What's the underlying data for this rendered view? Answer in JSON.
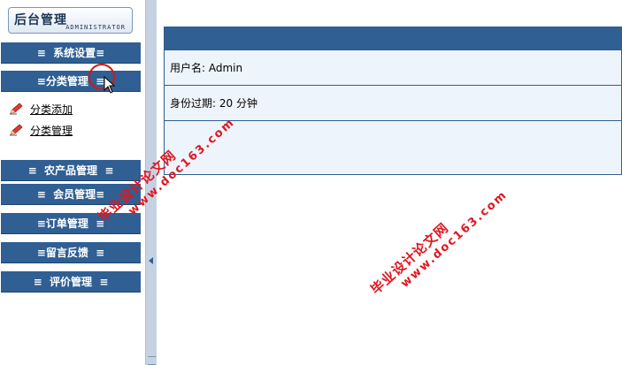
{
  "logo": {
    "title": "后台管理",
    "subtitle": "ADMINISTRATOR"
  },
  "sidebar": {
    "top_menus": [
      {
        "label": "≡  系统设置≡"
      },
      {
        "label": "≡分类管理  ≡"
      }
    ],
    "sub_items": [
      {
        "label": "分类添加",
        "icon": "pencil-icon"
      },
      {
        "label": "分类管理",
        "icon": "pencil-icon"
      }
    ],
    "bottom_menus": [
      {
        "label": "≡  农产品管理  ≡"
      },
      {
        "label": "≡  会员管理≡"
      },
      {
        "label": "≡订单管理  ≡"
      },
      {
        "label": "≡留言反馈  ≡"
      },
      {
        "label": "≡  评价管理  ≡"
      }
    ]
  },
  "main": {
    "username_line": "用户名: Admin",
    "expiry_line": "身份过期: 20 分钟"
  },
  "watermarks": [
    {
      "line1": "毕业设计论文网",
      "line2": "www.doc163.com"
    },
    {
      "line1": "毕业设计论文网",
      "line2": "www.doc163.com"
    }
  ],
  "colors": {
    "menu_bar": "#2f5f93",
    "row_bg": "#eef4fb",
    "splitter": "#c5d2e3",
    "watermark": "#e0161f"
  }
}
